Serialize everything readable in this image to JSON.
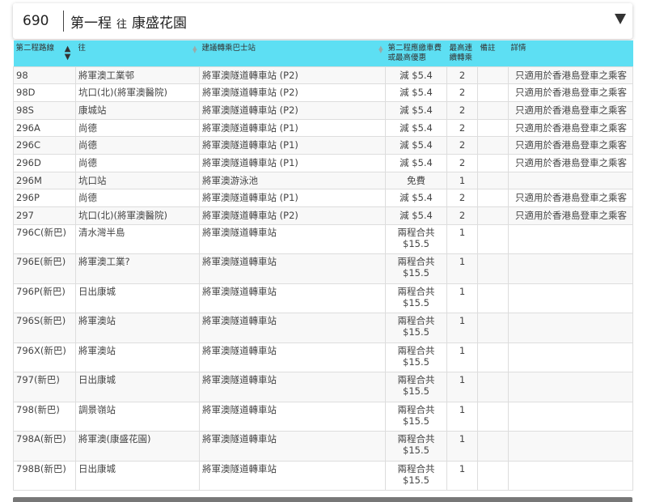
{
  "header": {
    "route_no": "690",
    "leg_label": "第一程",
    "to_label": "往",
    "destination": "康盛花園"
  },
  "table": {
    "columns": [
      "第二程路線",
      "往",
      "建議轉乘巴士站",
      "第二程應繳車費或最高優惠",
      "最高連續轉乘",
      "備註",
      "詳情"
    ],
    "rows": [
      {
        "route": "98",
        "to": "將軍澳工業邨",
        "stop": "將軍澳隧道轉車站 (P2)",
        "fare": "減 $5.4",
        "fare2": "",
        "max": "2",
        "remark": "",
        "detail": "只適用於香港島登車之乘客"
      },
      {
        "route": "98D",
        "to": "坑口(北)(將軍澳醫院)",
        "stop": "將軍澳隧道轉車站 (P2)",
        "fare": "減 $5.4",
        "fare2": "",
        "max": "2",
        "remark": "",
        "detail": "只適用於香港島登車之乘客"
      },
      {
        "route": "98S",
        "to": "康城站",
        "stop": "將軍澳隧道轉車站 (P2)",
        "fare": "減 $5.4",
        "fare2": "",
        "max": "2",
        "remark": "",
        "detail": "只適用於香港島登車之乘客"
      },
      {
        "route": "296A",
        "to": "尚德",
        "stop": "將軍澳隧道轉車站 (P1)",
        "fare": "減 $5.4",
        "fare2": "",
        "max": "2",
        "remark": "",
        "detail": "只適用於香港島登車之乘客"
      },
      {
        "route": "296C",
        "to": "尚德",
        "stop": "將軍澳隧道轉車站 (P1)",
        "fare": "減 $5.4",
        "fare2": "",
        "max": "2",
        "remark": "",
        "detail": "只適用於香港島登車之乘客"
      },
      {
        "route": "296D",
        "to": "尚德",
        "stop": "將軍澳隧道轉車站 (P1)",
        "fare": "減 $5.4",
        "fare2": "",
        "max": "2",
        "remark": "",
        "detail": "只適用於香港島登車之乘客"
      },
      {
        "route": "296M",
        "to": "坑口站",
        "stop": "將軍澳游泳池",
        "fare": "免費",
        "fare2": "",
        "max": "1",
        "remark": "",
        "detail": ""
      },
      {
        "route": "296P",
        "to": "尚德",
        "stop": "將軍澳隧道轉車站 (P1)",
        "fare": "減 $5.4",
        "fare2": "",
        "max": "2",
        "remark": "",
        "detail": "只適用於香港島登車之乘客"
      },
      {
        "route": "297",
        "to": "坑口(北)(將軍澳醫院)",
        "stop": "將軍澳隧道轉車站 (P2)",
        "fare": "減 $5.4",
        "fare2": "",
        "max": "2",
        "remark": "",
        "detail": "只適用於香港島登車之乘客"
      },
      {
        "route": "796C(新巴)",
        "to": "清水灣半島",
        "stop": "將軍澳隧道轉車站",
        "fare": "兩程合共",
        "fare2": "$15.5",
        "max": "1",
        "remark": "",
        "detail": ""
      },
      {
        "route": "796E(新巴)",
        "to": "將軍澳工業?",
        "stop": "將軍澳隧道轉車站",
        "fare": "兩程合共",
        "fare2": "$15.5",
        "max": "1",
        "remark": "",
        "detail": ""
      },
      {
        "route": "796P(新巴)",
        "to": "日出康城",
        "stop": "將軍澳隧道轉車站",
        "fare": "兩程合共",
        "fare2": "$15.5",
        "max": "1",
        "remark": "",
        "detail": ""
      },
      {
        "route": "796S(新巴)",
        "to": "將軍澳站",
        "stop": "將軍澳隧道轉車站",
        "fare": "兩程合共",
        "fare2": "$15.5",
        "max": "1",
        "remark": "",
        "detail": ""
      },
      {
        "route": "796X(新巴)",
        "to": "將軍澳站",
        "stop": "將軍澳隧道轉車站",
        "fare": "兩程合共",
        "fare2": "$15.5",
        "max": "1",
        "remark": "",
        "detail": ""
      },
      {
        "route": "797(新巴)",
        "to": "日出康城",
        "stop": "將軍澳隧道轉車站",
        "fare": "兩程合共",
        "fare2": "$15.5",
        "max": "1",
        "remark": "",
        "detail": ""
      },
      {
        "route": "798(新巴)",
        "to": "調景嶺站",
        "stop": "將軍澳隧道轉車站",
        "fare": "兩程合共",
        "fare2": "$15.5",
        "max": "1",
        "remark": "",
        "detail": ""
      },
      {
        "route": "798A(新巴)",
        "to": "將軍澳(康盛花園)",
        "stop": "將軍澳隧道轉車站",
        "fare": "兩程合共",
        "fare2": "$15.5",
        "max": "1",
        "remark": "",
        "detail": ""
      },
      {
        "route": "798B(新巴)",
        "to": "日出康城",
        "stop": "將軍澳隧道轉車站",
        "fare": "兩程合共",
        "fare2": "$15.5",
        "max": "1",
        "remark": "",
        "detail": ""
      }
    ]
  },
  "colors": {
    "header_bg": "#5ddff3",
    "row_alt": "#f8f8f8"
  },
  "icons": {
    "dropdown": "triangle-down-icon",
    "sort": "sort-arrows-icon"
  }
}
